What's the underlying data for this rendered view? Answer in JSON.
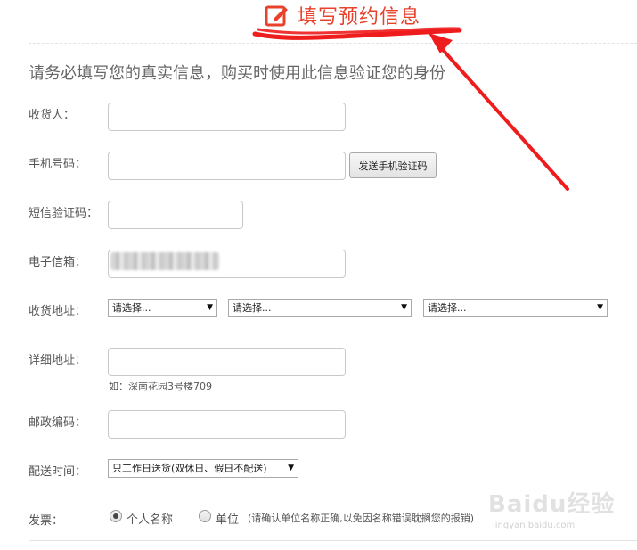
{
  "header": {
    "title": "填写预约信息",
    "accent_color": "#e8412c",
    "icon": "edit-icon"
  },
  "notice": "请务必填写您的真实信息，购买时使用此信息验证您的身份",
  "form": {
    "recipient": {
      "label": "收货人：",
      "value": ""
    },
    "phone": {
      "label": "手机号码：",
      "value": "",
      "send_code_button": "发送手机验证码"
    },
    "sms_code": {
      "label": "短信验证码：",
      "value": ""
    },
    "email": {
      "label": "电子信箱：",
      "value": ""
    },
    "address": {
      "label": "收货地址：",
      "province": "请选择...",
      "city": "请选择...",
      "district": "请选择..."
    },
    "detail_address": {
      "label": "详细地址：",
      "value": "",
      "hint": "如：深南花园3号楼709"
    },
    "postal_code": {
      "label": "邮政编码：",
      "value": ""
    },
    "delivery_time": {
      "label": "配送时间：",
      "selected": "只工作日送货(双休日、假日不配送)"
    },
    "invoice": {
      "label": "发票：",
      "options": [
        "个人名称",
        "单位"
      ],
      "selected": "个人名称",
      "note": "(请确认单位名称正确,以免因名称错误耽搁您的报销)"
    }
  },
  "annotation": {
    "color": "#ee1c1c"
  },
  "watermark": {
    "text": "Baidu经验",
    "sub": "jingyan.baidu.com"
  }
}
